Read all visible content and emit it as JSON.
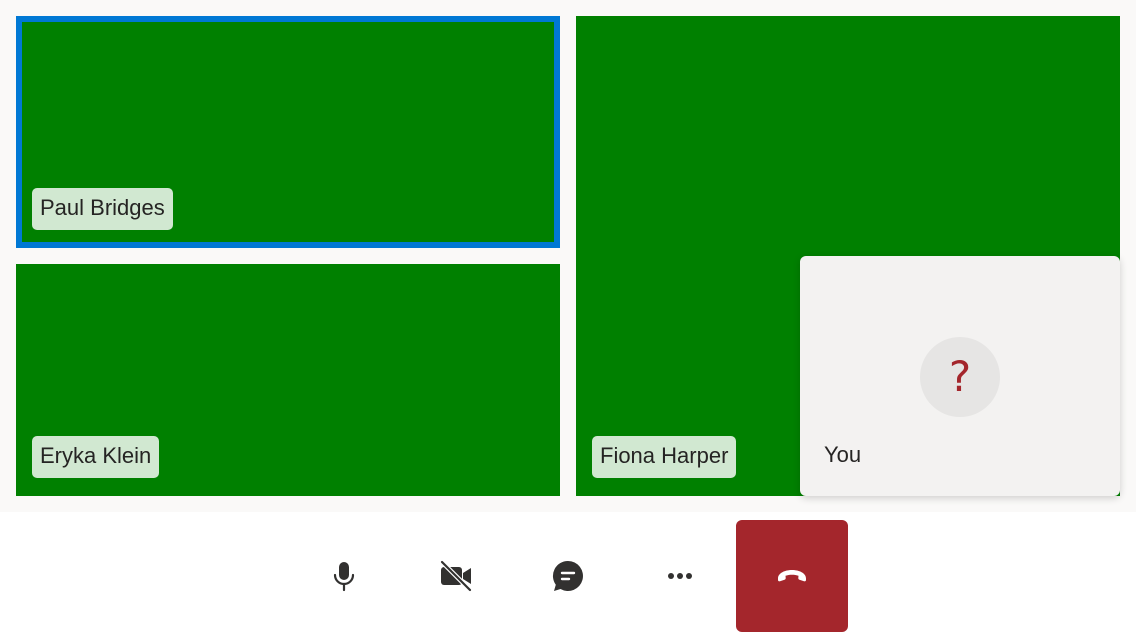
{
  "participants": {
    "tile_1": {
      "name": "Paul Bridges",
      "active_speaker": true
    },
    "tile_2": {
      "name": "Eryka Klein"
    },
    "tile_3": {
      "name": "Fiona Harper"
    }
  },
  "self_view": {
    "label": "You",
    "avatar_glyph": "?",
    "avatar_glyph_color": "#a4262c"
  },
  "toolbar": {
    "buttons": [
      {
        "icon": "microphone-icon"
      },
      {
        "icon": "camera-off-icon"
      },
      {
        "icon": "chat-icon"
      },
      {
        "icon": "more-options-icon"
      },
      {
        "icon": "hang-up-icon"
      }
    ]
  },
  "colors": {
    "video_background": "#008000",
    "active_speaker_border": "#0078d4",
    "hangup_background": "#a4262c"
  }
}
